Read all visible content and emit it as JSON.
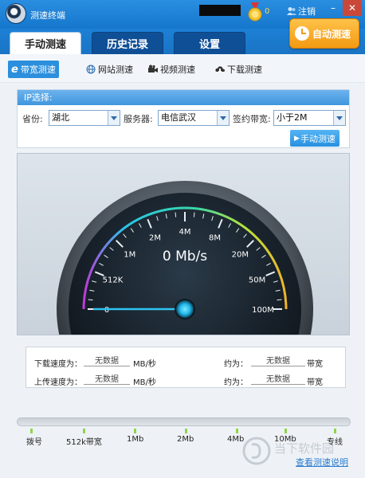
{
  "window": {
    "title": "测速终端",
    "medal_count": "0",
    "logout_label": "注销"
  },
  "nav": {
    "tabs": [
      {
        "label": "手动测速",
        "active": true
      },
      {
        "label": "历史记录",
        "active": false
      },
      {
        "label": "设置",
        "active": false
      }
    ],
    "auto_button": "自动测速"
  },
  "subnav": {
    "items": [
      {
        "label": "带宽测速",
        "active": true
      },
      {
        "label": "网站测速",
        "active": false
      },
      {
        "label": "视频测速",
        "active": false
      },
      {
        "label": "下载测速",
        "active": false
      }
    ]
  },
  "ip": {
    "header": "IP选择:",
    "province_label": "省份:",
    "province_value": "湖北",
    "server_label": "服务器:",
    "server_value": "电信武汉",
    "bandwidth_label": "签约带宽:",
    "bandwidth_value": "小于2M",
    "manual_button": "手动测速"
  },
  "gauge": {
    "speed_readout": "0 Mb/s",
    "scale_labels": [
      "0",
      "512K",
      "1M",
      "2M",
      "4M",
      "8M",
      "20M",
      "50M",
      "100M"
    ],
    "current_value_mbps": 0
  },
  "speed": {
    "download_label": "下载速度为：",
    "download_value": "无数据",
    "download_unit": "MB/秒",
    "download_approx_label": "约为：",
    "download_approx_value": "无数据",
    "download_approx_unit": "带宽",
    "upload_label": "上传速度为：",
    "upload_value": "无数据",
    "upload_unit": "MB/秒",
    "upload_approx_label": "约为：",
    "upload_approx_value": "无数据",
    "upload_approx_unit": "带宽"
  },
  "progress": {
    "labels": [
      "拨号",
      "512k带宽",
      "1Mb",
      "2Mb",
      "4Mb",
      "10Mb",
      "专线"
    ],
    "value_fraction": 0
  },
  "footer": {
    "help_link": "查看测速说明",
    "watermark": "当下软件园"
  },
  "colors": {
    "accent": "#1a7fd4",
    "gauge_needle": "#2ec4f0",
    "auto_button": "#f6a520"
  }
}
